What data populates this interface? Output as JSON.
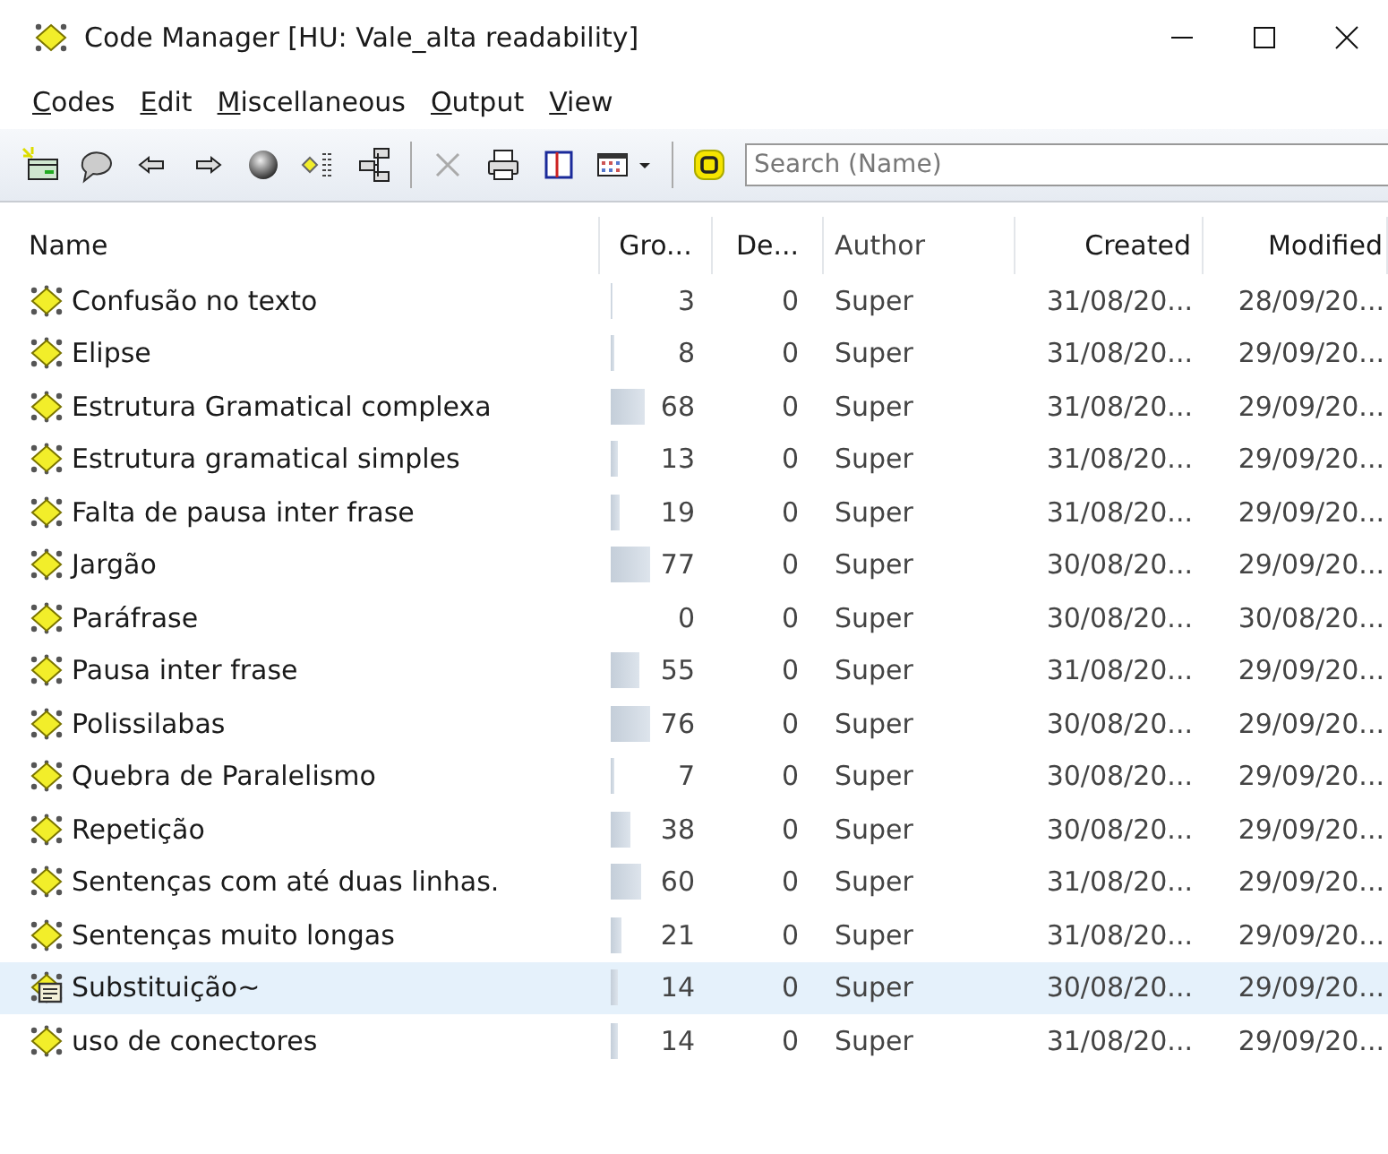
{
  "window": {
    "title": "Code Manager [HU: Vale_alta readability]"
  },
  "menu": [
    {
      "label": "Codes"
    },
    {
      "label": "Edit"
    },
    {
      "label": "Miscellaneous"
    },
    {
      "label": "Output"
    },
    {
      "label": "View"
    }
  ],
  "search": {
    "placeholder": "Search (Name)"
  },
  "table": {
    "columns": [
      "Name",
      "Gro...",
      "De...",
      "Author",
      "Created",
      "Modified"
    ],
    "rows": [
      {
        "name": "Confusão no texto",
        "kind": "code",
        "groundedness": "3",
        "density": "0",
        "author": "Super",
        "created": "31/08/20...",
        "modified": "28/09/20...",
        "selected": false
      },
      {
        "name": "Elipse",
        "kind": "code",
        "groundedness": "8",
        "density": "0",
        "author": "Super",
        "created": "31/08/20...",
        "modified": "29/09/20...",
        "selected": false
      },
      {
        "name": "Estrutura Gramatical complexa",
        "kind": "code",
        "groundedness": "68",
        "density": "0",
        "author": "Super",
        "created": "31/08/20...",
        "modified": "29/09/20...",
        "selected": false
      },
      {
        "name": "Estrutura gramatical simples",
        "kind": "code",
        "groundedness": "13",
        "density": "0",
        "author": "Super",
        "created": "31/08/20...",
        "modified": "29/09/20...",
        "selected": false
      },
      {
        "name": "Falta de pausa inter frase",
        "kind": "code",
        "groundedness": "19",
        "density": "0",
        "author": "Super",
        "created": "31/08/20...",
        "modified": "29/09/20...",
        "selected": false
      },
      {
        "name": "Jargão",
        "kind": "code",
        "groundedness": "77",
        "density": "0",
        "author": "Super",
        "created": "30/08/20...",
        "modified": "29/09/20...",
        "selected": false
      },
      {
        "name": "Paráfrase",
        "kind": "code",
        "groundedness": "0",
        "density": "0",
        "author": "Super",
        "created": "30/08/20...",
        "modified": "30/08/20...",
        "selected": false
      },
      {
        "name": "Pausa inter frase",
        "kind": "code",
        "groundedness": "55",
        "density": "0",
        "author": "Super",
        "created": "31/08/20...",
        "modified": "29/09/20...",
        "selected": false
      },
      {
        "name": "Polissilabas",
        "kind": "code",
        "groundedness": "76",
        "density": "0",
        "author": "Super",
        "created": "30/08/20...",
        "modified": "29/09/20...",
        "selected": false
      },
      {
        "name": "Quebra de Paralelismo",
        "kind": "code",
        "groundedness": "7",
        "density": "0",
        "author": "Super",
        "created": "30/08/20...",
        "modified": "29/09/20...",
        "selected": false
      },
      {
        "name": "Repetição",
        "kind": "code",
        "groundedness": "38",
        "density": "0",
        "author": "Super",
        "created": "30/08/20...",
        "modified": "29/09/20...",
        "selected": false
      },
      {
        "name": "Sentenças com até duas linhas.",
        "kind": "code",
        "groundedness": "60",
        "density": "0",
        "author": "Super",
        "created": "31/08/20...",
        "modified": "29/09/20...",
        "selected": false
      },
      {
        "name": "Sentenças muito longas",
        "kind": "code",
        "groundedness": "21",
        "density": "0",
        "author": "Super",
        "created": "31/08/20...",
        "modified": "29/09/20...",
        "selected": false
      },
      {
        "name": "Substituição~",
        "kind": "code-memo",
        "groundedness": "14",
        "density": "0",
        "author": "Super",
        "created": "30/08/20...",
        "modified": "29/09/20...",
        "selected": true
      },
      {
        "name": "uso de conectores",
        "kind": "code",
        "groundedness": "14",
        "density": "0",
        "author": "Super",
        "created": "31/08/20...",
        "modified": "29/09/20...",
        "selected": false
      }
    ]
  }
}
